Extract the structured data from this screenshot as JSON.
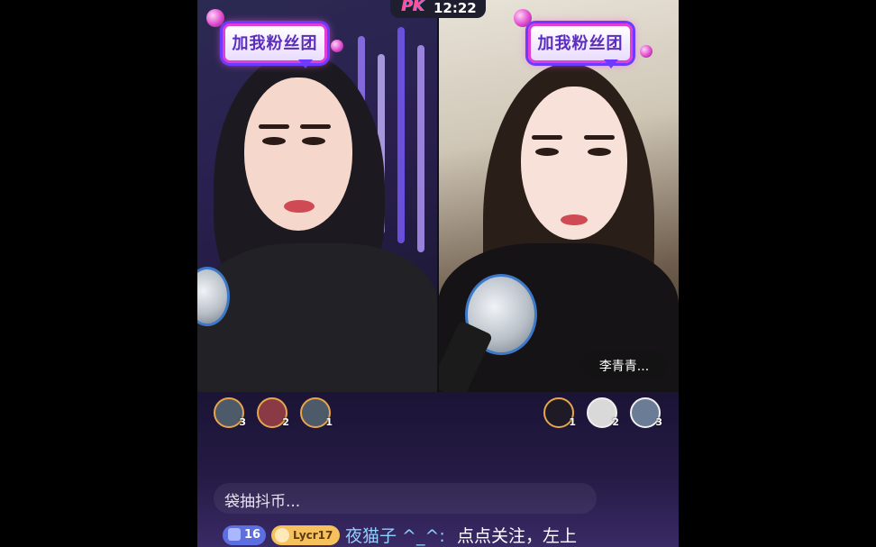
{
  "status_bar": {
    "pk_logo": "PK",
    "time": "12:22"
  },
  "panels": {
    "left": {
      "fan_club_badge": "加我粉丝团"
    },
    "right": {
      "fan_club_badge": "加我粉丝团",
      "anchor_name": "李青青..."
    }
  },
  "rankings": {
    "left": [
      {
        "rank": "3"
      },
      {
        "rank": "2"
      },
      {
        "rank": "1"
      }
    ],
    "right": [
      {
        "rank": "1"
      },
      {
        "rank": "2"
      },
      {
        "rank": "3"
      }
    ]
  },
  "chat": {
    "messages": [
      {
        "text": "袋抽抖币..."
      },
      {
        "level": "16",
        "fan_badge": "Lycr17",
        "user": "夜猫子 ^_^:",
        "text": "点点关注，左上"
      }
    ]
  },
  "colors": {
    "accent_pink": "#e23ed7",
    "level_badge": "#5d6fe0",
    "fan_badge": "#f6c15c",
    "username": "#8fd0ff"
  }
}
